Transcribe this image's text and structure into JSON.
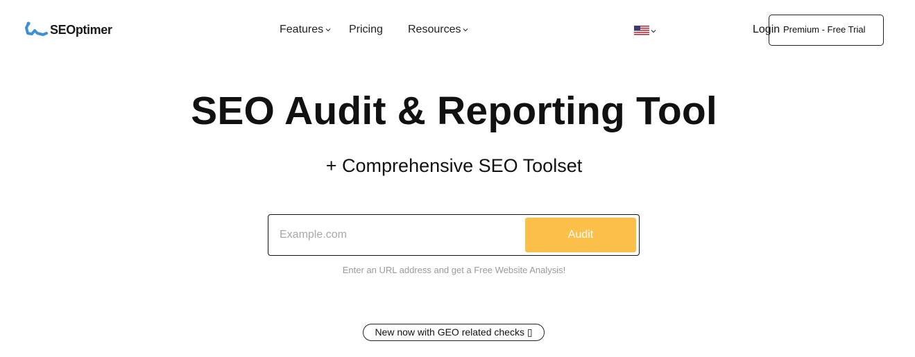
{
  "brand": {
    "logo_text": "SEOptimer",
    "logo_color": "#3d8fd6"
  },
  "nav": {
    "items": [
      {
        "label": "Features",
        "has_dropdown": true
      },
      {
        "label": "Pricing",
        "has_dropdown": false
      },
      {
        "label": "Resources",
        "has_dropdown": true
      }
    ],
    "language_icon": "us-flag-icon",
    "login_label": "Login",
    "premium_label": "Premium - Free Trial"
  },
  "hero": {
    "title": "SEO Audit & Reporting Tool",
    "subtitle": "+ Comprehensive SEO Toolset"
  },
  "audit": {
    "placeholder": "Example.com",
    "value": "",
    "button_label": "Audit",
    "button_color": "#fcbf4a",
    "helper_text": "Enter an URL address and get a Free Website Analysis!"
  },
  "badge": {
    "label": "New now with GEO related checks ▯"
  }
}
